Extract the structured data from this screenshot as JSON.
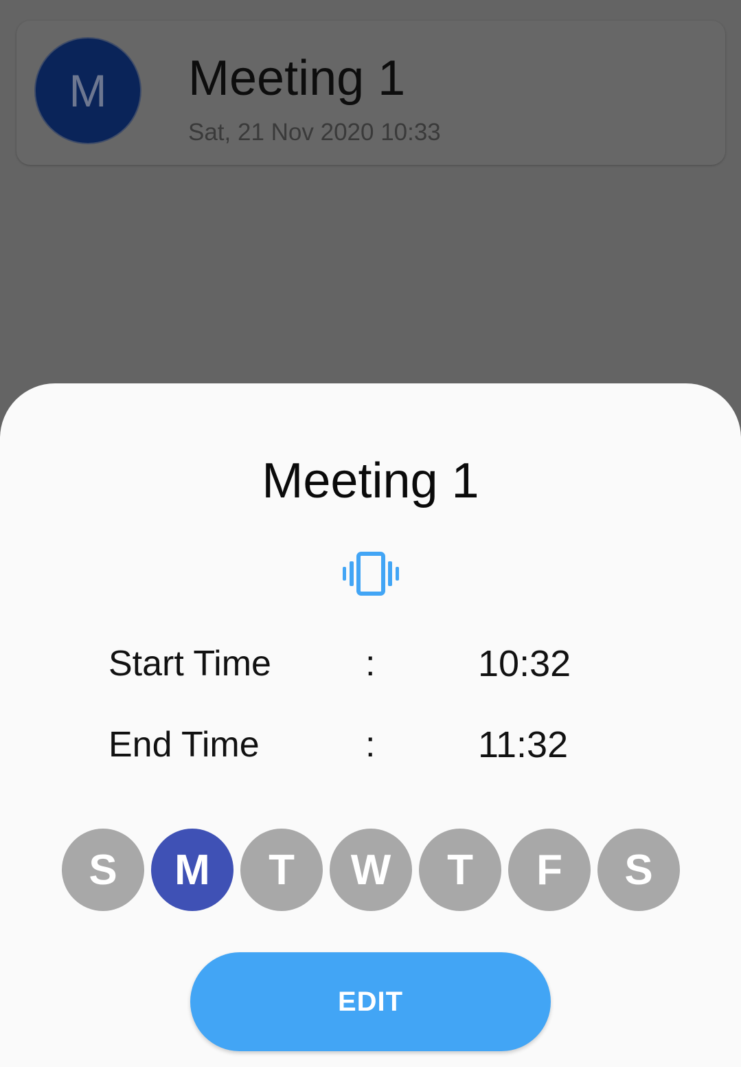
{
  "list_item": {
    "avatar_letter": "M",
    "title": "Meeting 1",
    "subtitle": "Sat, 21 Nov 2020 10:33",
    "avatar_color": "#0a2459"
  },
  "sheet": {
    "title": "Meeting 1",
    "mode_icon": "vibrate-icon",
    "mode_icon_color": "#42a5f5",
    "rows": [
      {
        "label": "Start Time",
        "separator": ":",
        "value": "10:32"
      },
      {
        "label": "End Time",
        "separator": ":",
        "value": "11:32"
      }
    ],
    "days": [
      {
        "letter": "S",
        "selected": false
      },
      {
        "letter": "M",
        "selected": true
      },
      {
        "letter": "T",
        "selected": false
      },
      {
        "letter": "W",
        "selected": false
      },
      {
        "letter": "T",
        "selected": false
      },
      {
        "letter": "F",
        "selected": false
      },
      {
        "letter": "S",
        "selected": false
      }
    ],
    "selected_day_color": "#3f51b5",
    "unselected_day_color": "#a8a8a8",
    "edit_label": "EDIT",
    "edit_color": "#42a5f5"
  }
}
